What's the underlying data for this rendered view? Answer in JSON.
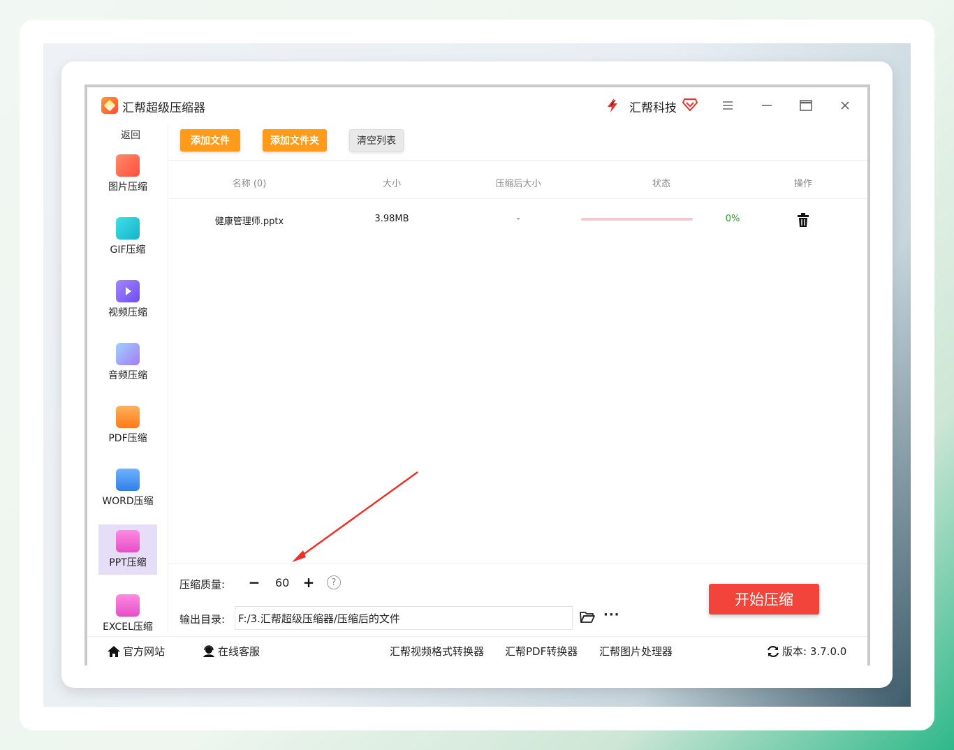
{
  "window": {
    "title": "汇帮超级压缩器",
    "brand": "汇帮科技"
  },
  "sidebar": {
    "back": "返回",
    "items": [
      {
        "label": "图片压缩",
        "icon": "image-icon",
        "color": "#ff6a4d"
      },
      {
        "label": "GIF压缩",
        "icon": "gif-icon",
        "color": "#22c8d8"
      },
      {
        "label": "视频压缩",
        "icon": "video-icon",
        "color": "#8b6bf2"
      },
      {
        "label": "音频压缩",
        "icon": "audio-icon",
        "color": "#7fb4ff"
      },
      {
        "label": "PDF压缩",
        "icon": "pdf-icon",
        "color": "#ff8a2a"
      },
      {
        "label": "WORD压缩",
        "icon": "word-icon",
        "color": "#3d8ef0"
      },
      {
        "label": "PPT压缩",
        "icon": "ppt-icon",
        "color": "#f06ad4",
        "active": true
      },
      {
        "label": "EXCEL压缩",
        "icon": "excel-icon",
        "color": "#f06ad4"
      }
    ]
  },
  "toolbar": {
    "add_file": "添加文件",
    "add_folder": "添加文件夹",
    "clear_list": "清空列表"
  },
  "table": {
    "columns": [
      "名称 (0)",
      "大小",
      "压缩后大小",
      "状态",
      "操作"
    ],
    "rows": [
      {
        "name": "健康管理师.pptx",
        "size": "3.98MB",
        "compressed_size": "-",
        "progress_percent": 0,
        "progress_text": "0%"
      }
    ]
  },
  "settings": {
    "quality_label": "压缩质量:",
    "quality_value": "60",
    "output_label": "输出目录:",
    "output_path": "F:/3.汇帮超级压缩器/压缩后的文件",
    "start_button": "开始压缩"
  },
  "footer": {
    "website": "官方网站",
    "support": "在线客服",
    "link_video": "汇帮视频格式转换器",
    "link_pdf": "汇帮PDF转换器",
    "link_image": "汇帮图片处理器",
    "version": "版本: 3.7.0.0"
  },
  "colors": {
    "accent_orange": "#ff9b1a",
    "start_red": "#f2443a",
    "progress_pink": "#f5c8d0",
    "percent_green": "#2a9d2a",
    "active_sidebar": "#e6ddf7",
    "annotation_arrow": "#e8322a"
  }
}
